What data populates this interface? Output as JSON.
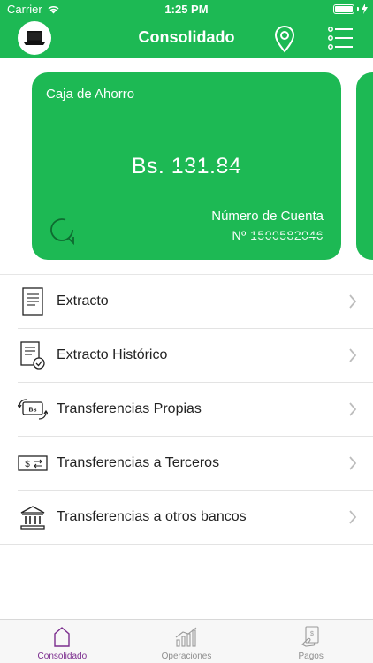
{
  "status_bar": {
    "carrier": "Carrier",
    "time": "1:25 PM"
  },
  "header": {
    "title": "Consolidado"
  },
  "account_card": {
    "type": "Caja de Ahorro",
    "balance_currency": "Bs.",
    "balance_amount": "131.84",
    "account_label": "Número de Cuenta",
    "account_prefix": "Nº",
    "account_number": "1500582046"
  },
  "menu": {
    "items": [
      {
        "label": "Extracto",
        "icon": "document-icon"
      },
      {
        "label": "Extracto Histórico",
        "icon": "document-history-icon"
      },
      {
        "label": "Transferencias Propias",
        "icon": "own-transfer-icon"
      },
      {
        "label": "Transferencias a Terceros",
        "icon": "third-party-transfer-icon"
      },
      {
        "label": "Transferencias a otros bancos",
        "icon": "bank-icon"
      }
    ]
  },
  "tabbar": {
    "tabs": [
      {
        "label": "Consolidado",
        "icon": "home-icon",
        "active": true
      },
      {
        "label": "Operaciones",
        "icon": "chart-icon",
        "active": false
      },
      {
        "label": "Pagos",
        "icon": "payment-icon",
        "active": false
      }
    ]
  },
  "colors": {
    "brand_green": "#1db954",
    "active_tab": "#7b2d8e",
    "inactive_tab": "#8e8e8e"
  }
}
